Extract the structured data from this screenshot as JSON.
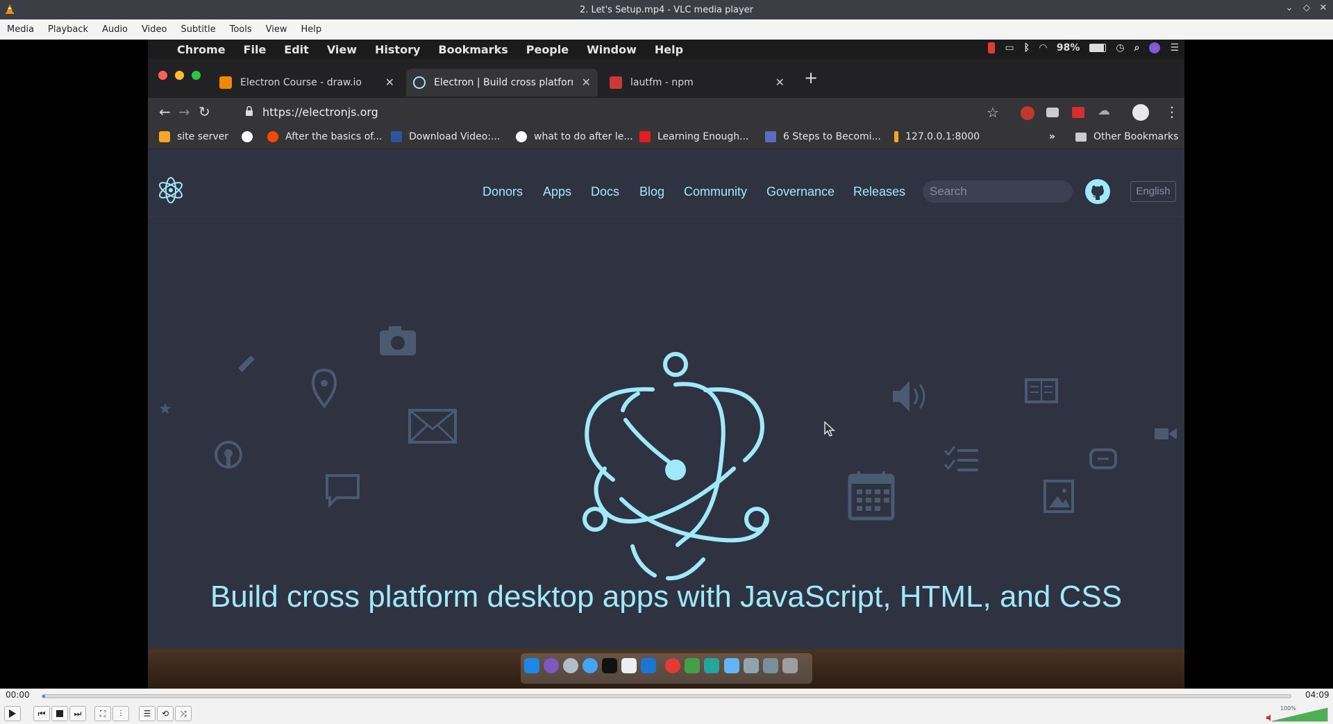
{
  "vlc": {
    "title": "2. Let's Setup.mp4 - VLC media player",
    "menu": [
      "Media",
      "Playback",
      "Audio",
      "Video",
      "Subtitle",
      "Tools",
      "View",
      "Help"
    ],
    "time_elapsed": "00:00",
    "time_total": "04:09",
    "playback_progress": 0.002,
    "volume_label": "100%",
    "volume_level": 1.0
  },
  "mac_menu": {
    "items": [
      "Chrome",
      "File",
      "Edit",
      "View",
      "History",
      "Bookmarks",
      "People",
      "Window",
      "Help"
    ],
    "battery": "98%"
  },
  "chrome": {
    "tabs": [
      {
        "title": "Electron Course - draw.io",
        "favicon_color": "#f08705"
      },
      {
        "title": "Electron | Build cross platform",
        "favicon_color": "#9feaf9"
      },
      {
        "title": "lautfm - npm",
        "favicon_color": "#cb3837"
      }
    ],
    "active_tab": 1,
    "url": "https://electronjs.org",
    "bookmarks": [
      {
        "label": "site server",
        "icon_color": "#f5a623"
      },
      {
        "label": "",
        "icon_color": "#ffffff"
      },
      {
        "label": "After the basics of...",
        "icon_color": "#ff4500"
      },
      {
        "label": "Download Video:...",
        "icon_color": "#2b579a"
      },
      {
        "label": "what to do after le...",
        "icon_color": "#ffffff"
      },
      {
        "label": "Learning Enough...",
        "icon_color": "#e31b23"
      },
      {
        "label": "6 Steps to Becomi...",
        "icon_color": "#5c6bc0"
      },
      {
        "label": "127.0.0.1:8000",
        "icon_color": "#f5a623"
      }
    ],
    "bookmarks_overflow": "»",
    "other_bookmarks": "Other Bookmarks"
  },
  "site": {
    "nav": [
      "Donors",
      "Apps",
      "Docs",
      "Blog",
      "Community",
      "Governance",
      "Releases"
    ],
    "search_placeholder": "Search",
    "language": "English",
    "tagline": "Build cross platform desktop apps with JavaScript, HTML, and CSS"
  },
  "colors": {
    "electron_blue": "#9feaf9",
    "page_bg": "#2f3241",
    "bg_icon": "#4a5a70"
  }
}
